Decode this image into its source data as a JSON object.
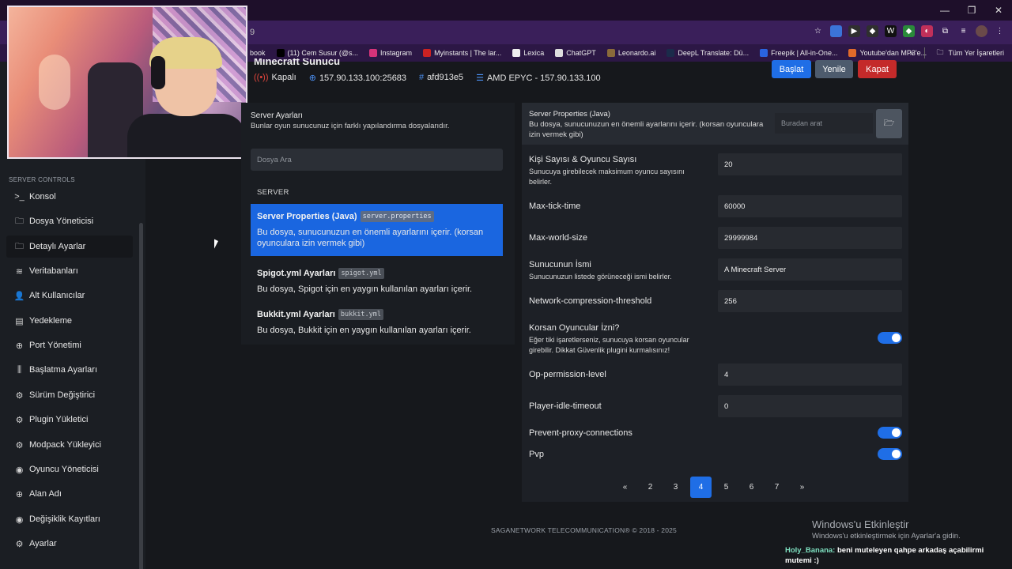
{
  "browser": {
    "url_fragment": "9",
    "bookmarks": [
      {
        "label": "book",
        "color": "#333333"
      },
      {
        "label": "(11) Cem Susur (@s...",
        "color": "#000000"
      },
      {
        "label": "Instagram",
        "color": "#d6337a"
      },
      {
        "label": "Myinstants | The lar...",
        "color": "#cc2222"
      },
      {
        "label": "Lexica",
        "color": "#eeeeee"
      },
      {
        "label": "ChatGPT",
        "color": "#dddddd"
      },
      {
        "label": "Leonardo.ai",
        "color": "#8a6a3a"
      },
      {
        "label": "DeepL Translate: Dü...",
        "color": "#1b2b4a"
      },
      {
        "label": "Freepik | All-in-One...",
        "color": "#2a64e0"
      },
      {
        "label": "Youtube'dan MP3'e...",
        "color": "#e06a2a"
      }
    ],
    "bookmarks_more": "»",
    "all_bookmarks": "Tüm Yer İşaretleri"
  },
  "server": {
    "title": "Minecraft Sunucu",
    "status": "Kapalı",
    "address": "157.90.133.100:25683",
    "id": "afd913e5",
    "node": "AMD EPYC - 157.90.133.100",
    "buttons": {
      "start": "Başlat",
      "refresh": "Yenile",
      "stop": "Kapat"
    }
  },
  "sidebar": {
    "section_label": "SERVER CONTROLS",
    "items": [
      {
        "label": "Konsol",
        "icon": "terminal-icon",
        "glyph": ">_"
      },
      {
        "label": "Dosya Yöneticisi",
        "icon": "folder-icon",
        "glyph": "🗀"
      },
      {
        "label": "Detaylı Ayarlar",
        "icon": "folder-icon",
        "glyph": "🗀"
      },
      {
        "label": "Veritabanları",
        "icon": "database-icon",
        "glyph": "≋"
      },
      {
        "label": "Alt Kullanıcılar",
        "icon": "users-icon",
        "glyph": "👤"
      },
      {
        "label": "Yedekleme",
        "icon": "archive-icon",
        "glyph": "▤"
      },
      {
        "label": "Port Yönetimi",
        "icon": "globe-icon",
        "glyph": "⊕"
      },
      {
        "label": "Başlatma Ayarları",
        "icon": "sliders-icon",
        "glyph": "⫼"
      },
      {
        "label": "Sürüm Değiştirici",
        "icon": "gear-icon",
        "glyph": "⚙"
      },
      {
        "label": "Plugin Yükletici",
        "icon": "gear-icon",
        "glyph": "⚙"
      },
      {
        "label": "Modpack Yükleyici",
        "icon": "gear-icon",
        "glyph": "⚙"
      },
      {
        "label": "Oyuncu Yöneticisi",
        "icon": "eye-icon",
        "glyph": "◉"
      },
      {
        "label": "Alan Adı",
        "icon": "globe-icon",
        "glyph": "⊕"
      },
      {
        "label": "Değişiklik Kayıtları",
        "icon": "eye-icon",
        "glyph": "◉"
      },
      {
        "label": "Ayarlar",
        "icon": "gear-icon",
        "glyph": "⚙"
      }
    ]
  },
  "settings_panel": {
    "title": "Server Ayarları",
    "subtitle": "Bunlar oyun sunucunuz için farklı yapılandırma dosyalarıdır.",
    "search_placeholder": "Dosya Ara",
    "group": "SERVER",
    "files": [
      {
        "name": "Server Properties (Java)",
        "code": "server.properties",
        "desc": "Bu dosya, sunucunuzun en önemli ayarlarını içerir. (korsan oyunculara izin vermek gibi)"
      },
      {
        "name": "Spigot.yml Ayarları",
        "code": "spigot.yml",
        "desc": "Bu dosya, Spigot için en yaygın kullanılan ayarları içerir."
      },
      {
        "name": "Bukkit.yml Ayarları",
        "code": "bukkit.yml",
        "desc": "Bu dosya, Bukkit için en yaygın kullanılan ayarları içerir."
      }
    ]
  },
  "properties_panel": {
    "title": "Server Properties (Java)",
    "subtitle": "Bu dosya, sunucunuzun en önemli ayarlarını içerir. (korsan oyunculara izin vermek gibi)",
    "search_placeholder": "Buradan arat",
    "props": [
      {
        "label": "Kişi Sayısı & Oyuncu Sayısı",
        "desc": "Sunucuya girebilecek maksimum oyuncu sayısını belirler.",
        "value": "20"
      },
      {
        "label": "Max-tick-time",
        "value": "60000"
      },
      {
        "label": "Max-world-size",
        "value": "29999984"
      },
      {
        "label": "Sunucunun İsmi",
        "desc": "Sunucunuzun listede görüneceği ismi belirler.",
        "value": "A Minecraft Server"
      },
      {
        "label": "Network-compression-threshold",
        "value": "256"
      },
      {
        "label": "Korsan Oyuncular İzni?",
        "desc": "Eğer tiki işaretlerseniz, sunucuya korsan oyuncular girebilir. Dikkat Güvenlik plugini kurmalısınız!",
        "toggle": true
      },
      {
        "label": "Op-permission-level",
        "value": "4"
      },
      {
        "label": "Player-idle-timeout",
        "value": "0"
      },
      {
        "label": "Prevent-proxy-connections",
        "toggle": true
      },
      {
        "label": "Pvp",
        "toggle": true
      }
    ],
    "pagination": {
      "prev": "«",
      "pages": [
        "2",
        "3",
        "4",
        "5",
        "6",
        "7"
      ],
      "current": "4",
      "next": "»"
    }
  },
  "footer": "SAGANETWORK TELECOMMUNICATION® © 2018 - 2025",
  "watermark": {
    "line1": "Windows'u Etkinleştir",
    "line2": "Windows'u etkinleştirmek için Ayarlar'a gidin."
  },
  "chat": {
    "user": "Holy_Banana:",
    "message": " beni muteleyen qahpe arkadaş açabilirmi mutemi :)"
  },
  "colors": {
    "accent": "#1f6ee6",
    "danger": "#c42a2a",
    "secondary": "#4d5b6d"
  }
}
